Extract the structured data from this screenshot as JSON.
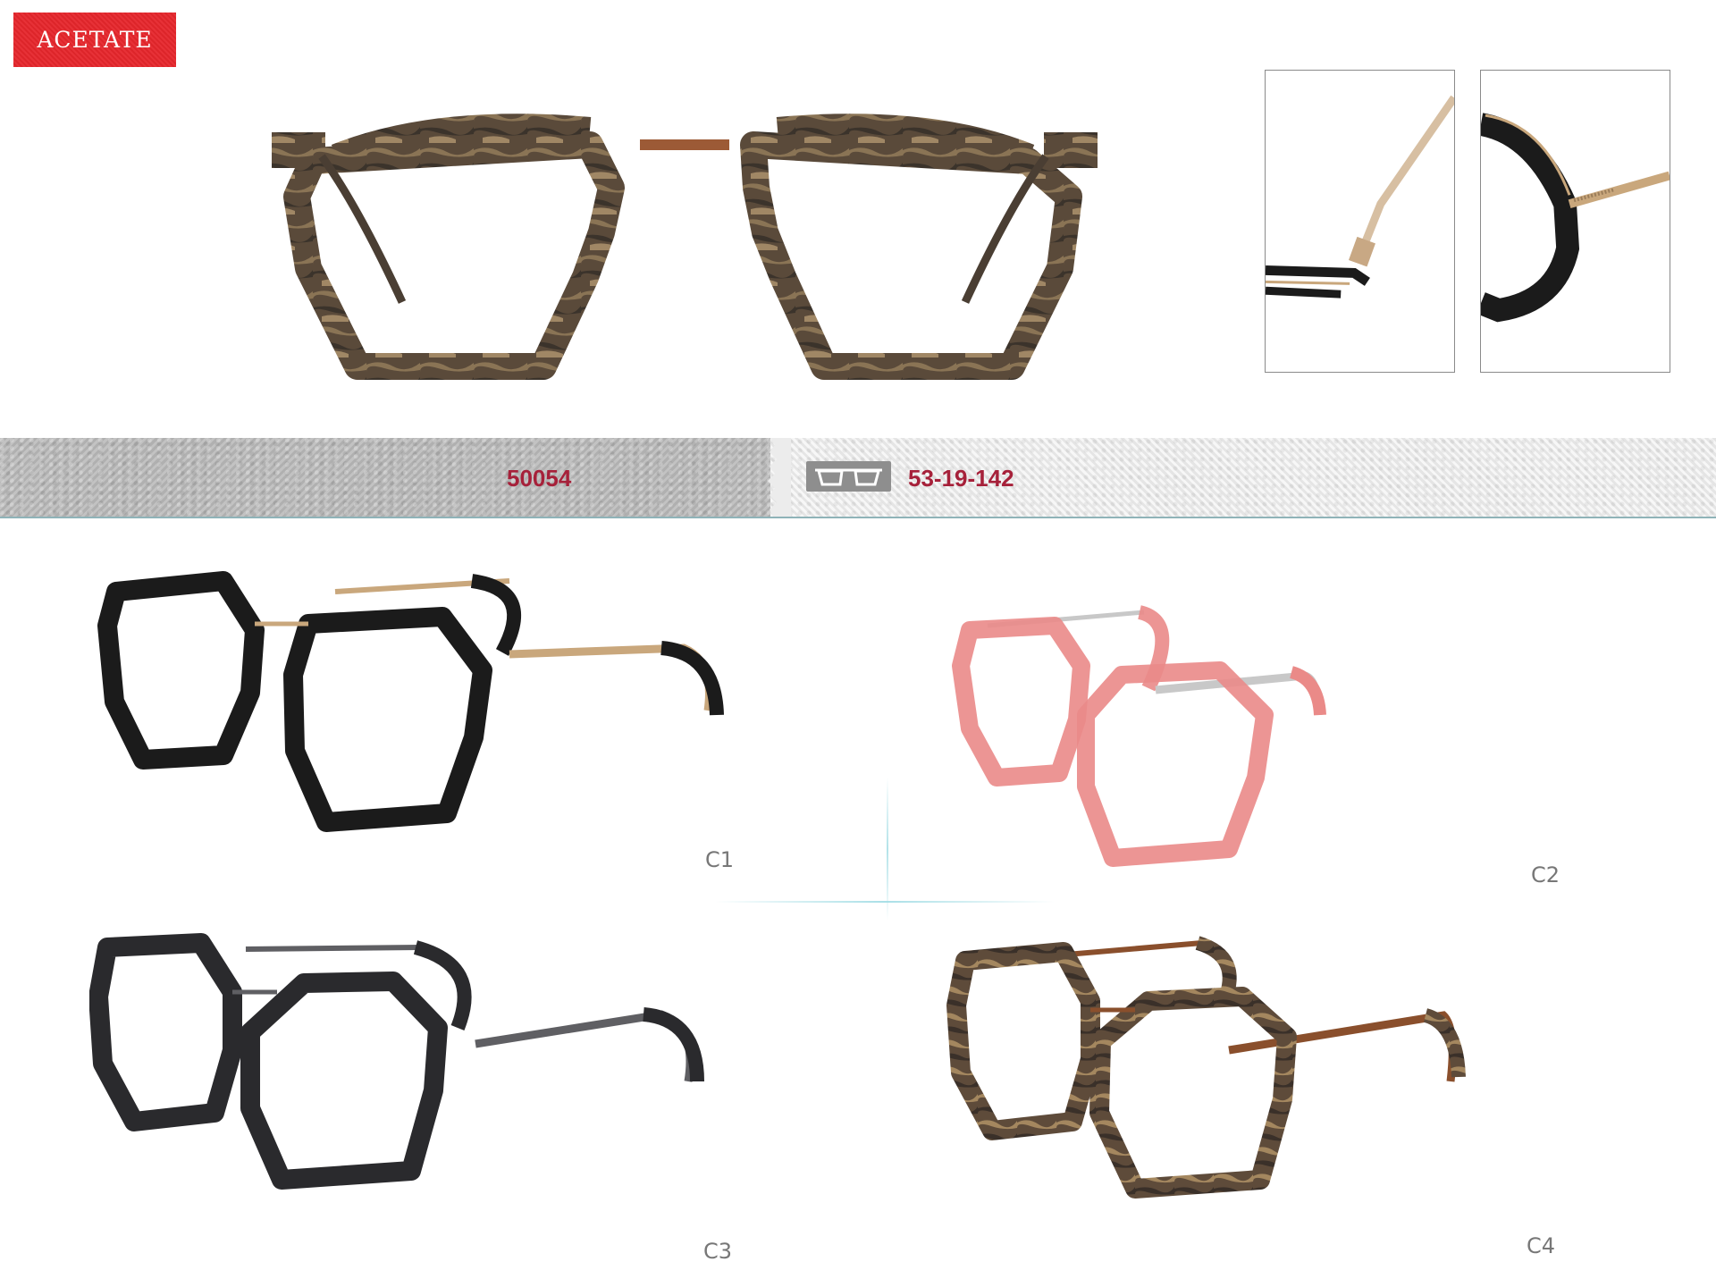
{
  "badge": {
    "text": "ACETATE"
  },
  "info": {
    "model": "50054",
    "size": "53-19-142"
  },
  "variants": [
    {
      "label": "C1",
      "frame": "#1b1b1b",
      "metal": "#c9a77c"
    },
    {
      "label": "C2",
      "frame": "#ea8a88",
      "metal": "#c8c8c8"
    },
    {
      "label": "C3",
      "frame": "#2a2a2d",
      "metal": "#5f5f63"
    },
    {
      "label": "C4",
      "frame": "#6b5340",
      "metal": "#8a4f2c"
    }
  ],
  "icons": [
    "glasses-size-icon"
  ]
}
